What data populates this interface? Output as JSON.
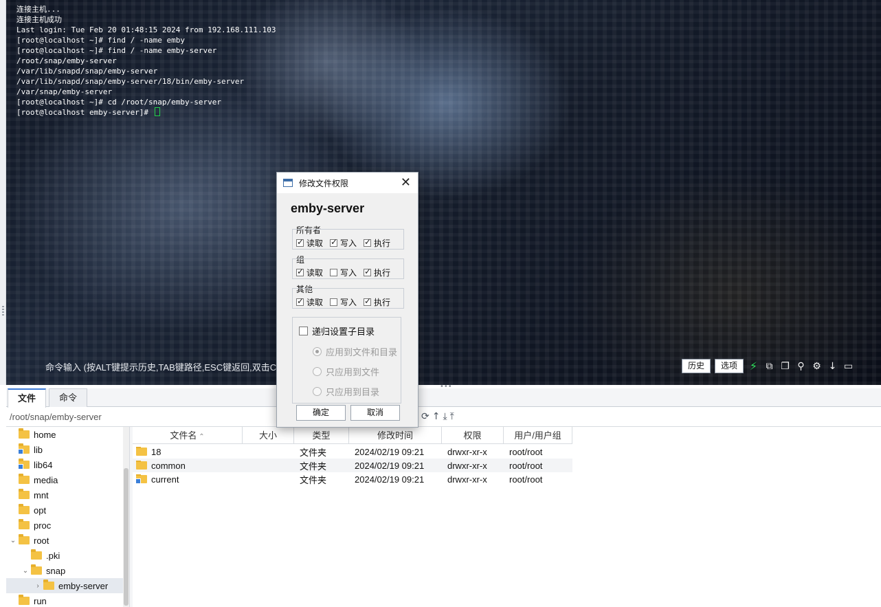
{
  "terminal": {
    "lines": [
      "连接主机...",
      "连接主机成功",
      "Last login: Tue Feb 20 01:48:15 2024 from 192.168.111.103",
      "[root@localhost ~]# find / -name emby",
      "[root@localhost ~]# find / -name emby-server",
      "/root/snap/emby-server",
      "/var/lib/snapd/snap/emby-server",
      "/var/lib/snapd/snap/emby-server/18/bin/emby-server",
      "/var/snap/emby-server",
      "[root@localhost ~]# cd /root/snap/emby-server",
      "[root@localhost emby-server]# "
    ],
    "command_hint": "命令输入 (按ALT键提示历史,TAB键路径,ESC键返回,双击CT",
    "history_label": "历史",
    "options_label": "选项"
  },
  "tabs": [
    "文件",
    "命令"
  ],
  "path": "/root/snap/emby-server",
  "tree": [
    {
      "label": "home",
      "level": 0
    },
    {
      "label": "lib",
      "level": 0,
      "link": true
    },
    {
      "label": "lib64",
      "level": 0,
      "link": true
    },
    {
      "label": "media",
      "level": 0
    },
    {
      "label": "mnt",
      "level": 0
    },
    {
      "label": "opt",
      "level": 0
    },
    {
      "label": "proc",
      "level": 0
    },
    {
      "label": "root",
      "level": 0,
      "expanded": true
    },
    {
      "label": ".pki",
      "level": 1
    },
    {
      "label": "snap",
      "level": 1,
      "expanded": true
    },
    {
      "label": "emby-server",
      "level": 2,
      "selected": true,
      "collapsed": true
    },
    {
      "label": "run",
      "level": 0
    }
  ],
  "file_table": {
    "headers": [
      "文件名",
      "大小",
      "类型",
      "修改时间",
      "权限",
      "用户/用户组"
    ],
    "rows": [
      {
        "name": "18",
        "size": "",
        "type": "文件夹",
        "mtime": "2024/02/19 09:21",
        "perm": "drwxr-xr-x",
        "owner": "root/root",
        "link": false
      },
      {
        "name": "common",
        "size": "",
        "type": "文件夹",
        "mtime": "2024/02/19 09:21",
        "perm": "drwxr-xr-x",
        "owner": "root/root",
        "link": false
      },
      {
        "name": "current",
        "size": "",
        "type": "文件夹",
        "mtime": "2024/02/19 09:21",
        "perm": "drwxr-xr-x",
        "owner": "root/root",
        "link": true
      }
    ]
  },
  "dialog": {
    "title": "修改文件权限",
    "filename": "emby-server",
    "groups": [
      {
        "label": "所有者",
        "read": true,
        "write": true,
        "exec": true
      },
      {
        "label": "组",
        "read": true,
        "write": false,
        "exec": true
      },
      {
        "label": "其他",
        "read": true,
        "write": false,
        "exec": true
      }
    ],
    "perm_labels": {
      "read": "读取",
      "write": "写入",
      "exec": "执行"
    },
    "recursive_label": "递归设置子目录",
    "recursive": false,
    "options": [
      "应用到文件和目录",
      "只应用到文件",
      "只应用到目录"
    ],
    "selected_option": 0,
    "ok_label": "确定",
    "cancel_label": "取消"
  }
}
